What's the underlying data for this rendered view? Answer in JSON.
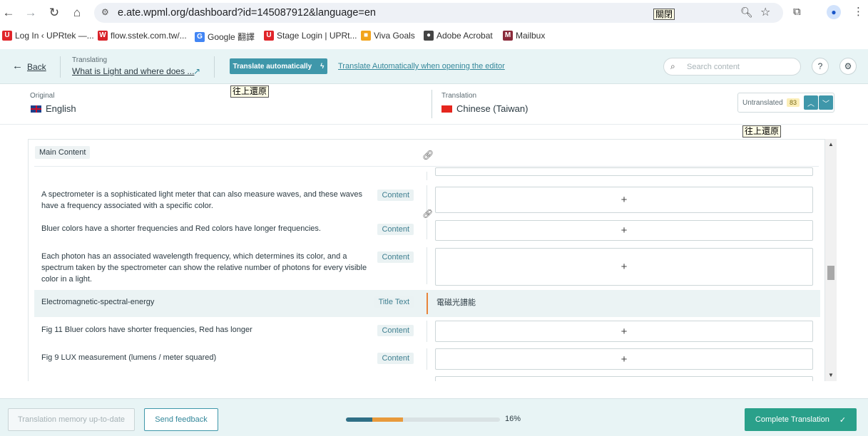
{
  "browser": {
    "url": "e.ate.wpml.org/dashboard?id=145087912&language=en",
    "url_popup": "關閉",
    "bookmarks": [
      {
        "label": "Log In ‹ UPRtek —...",
        "icon": "U",
        "color": "#e0252a"
      },
      {
        "label": "flow.sstek.com.tw/...",
        "icon": "W",
        "color": "#d9232a"
      },
      {
        "label": "Google 翻譯",
        "icon": "G",
        "color": "#4285f4"
      },
      {
        "label": "Stage Login | UPRt...",
        "icon": "U",
        "color": "#e0252a"
      },
      {
        "label": "Viva Goals",
        "icon": "■",
        "color": "#f2a41c"
      },
      {
        "label": "Adobe Acrobat",
        "icon": "●",
        "color": "#444444"
      },
      {
        "label": "Mailbux",
        "icon": "M",
        "color": "#8a2a3a"
      }
    ]
  },
  "header": {
    "back_label": "Back",
    "translating_label": "Translating",
    "title": "What is Light and where does ...",
    "auto_button": "Translate automatically",
    "auto_link": "Translate Automatically when opening the editor",
    "search_placeholder": "Search content",
    "tooltip_top": "往上還原",
    "tooltip_right": "往上還原"
  },
  "languages": {
    "original_label": "Original",
    "original_name": "English",
    "translation_label": "Translation",
    "translation_name": "Chinese (Taiwan)",
    "untranslated_label": "Untranslated",
    "untranslated_count": "83"
  },
  "panel": {
    "section": "Main Content",
    "rows": [
      {
        "source": "A spectrometer is a sophisticated light meter that can also measure waves, and these waves have a frequency associated with a specific color.",
        "type": "Content",
        "target": "+"
      },
      {
        "source": "Bluer colors have a shorter frequencies and Red colors have longer frequencies.",
        "type": "Content",
        "target": "+"
      },
      {
        "source": "Each photon has an associated wavelength frequency, which determines its color, and a spectrum taken by the spectrometer can show the relative number of photons for every visible color in a light.",
        "type": "Content",
        "target": "+"
      },
      {
        "source": "Electromagnetic-spectral-energy",
        "type": "Title Text",
        "target": "電磁光譜能"
      },
      {
        "source": "Fig 11 Bluer colors have shorter frequencies, Red has longer",
        "type": "Content",
        "target": "+"
      },
      {
        "source": "Fig 9 LUX measurement (lumens / meter squared)",
        "type": "Content",
        "target": "+"
      }
    ]
  },
  "footer": {
    "tm_button": "Translation memory up-to-date",
    "feedback_button": "Send feedback",
    "progress_translated": 0.17,
    "progress_partial": 0.2,
    "progress_label": "16%",
    "complete_button": "Complete Translation"
  },
  "colors": {
    "accent": "#3f97aa",
    "complete": "#2aa08a",
    "progress_done": "#2f6f86",
    "progress_partial": "#e89a3c"
  }
}
